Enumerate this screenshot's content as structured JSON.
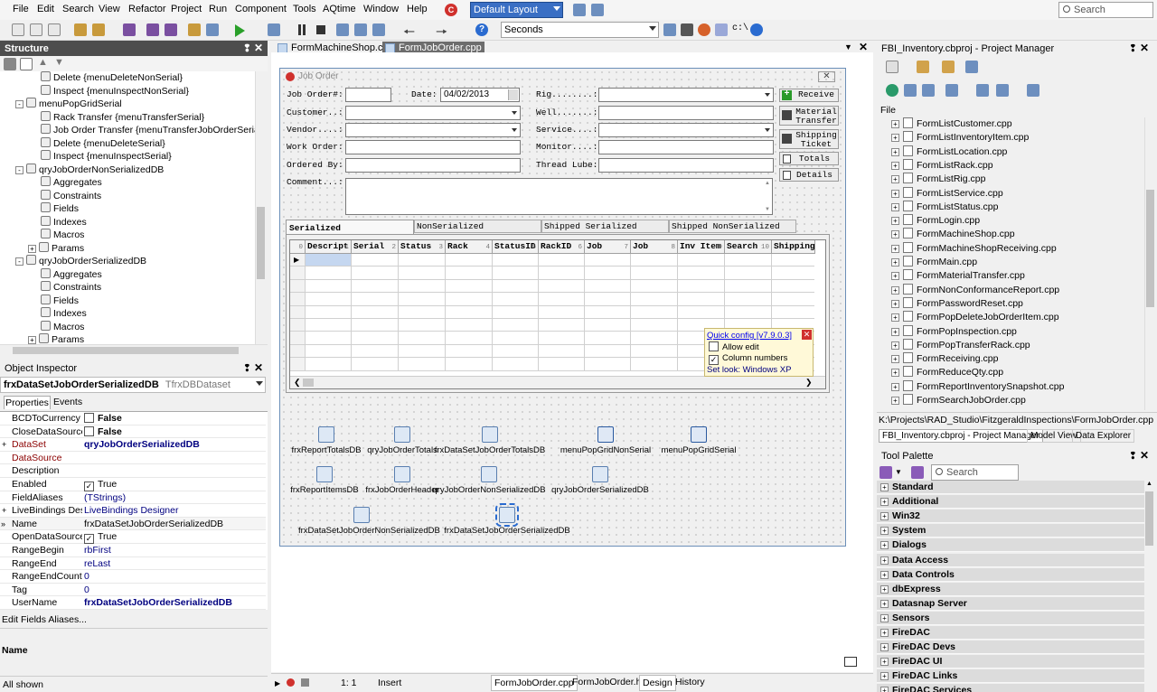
{
  "menu": {
    "items": [
      "File",
      "Edit",
      "Search",
      "View",
      "Refactor",
      "Project",
      "Run",
      "Component",
      "Tools",
      "AQtime",
      "Window",
      "Help"
    ],
    "layout_combo": "Default Layout",
    "search_placeholder": "Search"
  },
  "toolbar": {
    "time_unit": "Seconds"
  },
  "editor_tabs": [
    "FormMachineShop.cpp",
    "FormJobOrder.cpp"
  ],
  "structure": {
    "title": "Structure",
    "rows": [
      {
        "label": "Delete {menuDeleteNonSerial}",
        "indent": 3
      },
      {
        "label": "Inspect {menuInspectNonSerial}",
        "indent": 3
      },
      {
        "label": "menuPopGridSerial",
        "indent": 1,
        "exp": "-"
      },
      {
        "label": "Rack Transfer {menuTransferSerial}",
        "indent": 3
      },
      {
        "label": "Job Order Transfer {menuTransferJobOrderSerial}",
        "indent": 3
      },
      {
        "label": "Delete {menuDeleteSerial}",
        "indent": 3
      },
      {
        "label": "Inspect {menuInspectSerial}",
        "indent": 3
      },
      {
        "label": "qryJobOrderNonSerializedDB",
        "indent": 1,
        "exp": "-"
      },
      {
        "label": "Aggregates",
        "indent": 3
      },
      {
        "label": "Constraints",
        "indent": 3
      },
      {
        "label": "Fields",
        "indent": 3
      },
      {
        "label": "Indexes",
        "indent": 3
      },
      {
        "label": "Macros",
        "indent": 3
      },
      {
        "label": "Params",
        "indent": 2,
        "exp": "+"
      },
      {
        "label": "qryJobOrderSerializedDB",
        "indent": 1,
        "exp": "-"
      },
      {
        "label": "Aggregates",
        "indent": 3
      },
      {
        "label": "Constraints",
        "indent": 3
      },
      {
        "label": "Fields",
        "indent": 3
      },
      {
        "label": "Indexes",
        "indent": 3
      },
      {
        "label": "Macros",
        "indent": 3
      },
      {
        "label": "Params",
        "indent": 2,
        "exp": "+"
      }
    ]
  },
  "object_inspector": {
    "title": "Object Inspector",
    "selected_name": "frxDataSetJobOrderSerializedDB",
    "selected_type": "TfrxDBDataset",
    "tabs": [
      "Properties",
      "Events"
    ],
    "rows": [
      {
        "key": "BCDToCurrency",
        "value": "False",
        "chk": "off",
        "bold": true
      },
      {
        "key": "CloseDataSource",
        "value": "False",
        "chk": "off",
        "bold": true
      },
      {
        "key": "DataSet",
        "value": "qryJobOrderSerializedDB",
        "exp": "+",
        "keycolor": "#8b0000",
        "valcolor": "#000080",
        "bold": true
      },
      {
        "key": "DataSource",
        "value": "",
        "keycolor": "#8b0000"
      },
      {
        "key": "Description",
        "value": ""
      },
      {
        "key": "Enabled",
        "value": "True",
        "chk": "on"
      },
      {
        "key": "FieldAliases",
        "value": "(TStrings)",
        "valcolor": "#000080"
      },
      {
        "key": "LiveBindings Designer",
        "value": "LiveBindings Designer",
        "exp": "+",
        "valcolor": "#000080"
      },
      {
        "key": "Name",
        "value": "frxDataSetJobOrderSerializedDB",
        "selected": true
      },
      {
        "key": "OpenDataSource",
        "value": "True",
        "chk": "on"
      },
      {
        "key": "RangeBegin",
        "value": "rbFirst",
        "valcolor": "#000080"
      },
      {
        "key": "RangeEnd",
        "value": "reLast",
        "valcolor": "#000080"
      },
      {
        "key": "RangeEndCount",
        "value": "0",
        "valcolor": "#000080"
      },
      {
        "key": "Tag",
        "value": "0",
        "valcolor": "#000080"
      },
      {
        "key": "UserName",
        "value": "frxDataSetJobOrderSerializedDB",
        "valcolor": "#000080",
        "bold": true
      }
    ],
    "footer_link": "Edit Fields Aliases...",
    "desc_name": "Name",
    "status": "All shown"
  },
  "form": {
    "caption": "Job Order",
    "labels": {
      "job_order": "Job Order#:",
      "date": "Date:",
      "customer": "Customer..:",
      "vendor": "Vendor....:",
      "work_order": "Work Order:",
      "ordered_by": "Ordered By:",
      "comment": "Comment...:",
      "rig": "Rig........:",
      "well": "Well.......:",
      "service": "Service....:",
      "monitor": "Monitor....:",
      "thread_lube": "Thread Lube:"
    },
    "date_value": "04/02/2013",
    "buttons": {
      "receive": "Receive",
      "material_transfer_1": "Material",
      "material_transfer_2": "Transfer",
      "shipping_ticket_1": "Shipping",
      "shipping_ticket_2": "Ticket",
      "totals": "Totals",
      "details": "Details"
    },
    "grid_tabs": [
      "Serialized",
      "NonSerialized",
      "Shipped Serialized",
      "Shipped NonSerialized"
    ],
    "grid_columns": [
      {
        "label": "Descript",
        "num": "1"
      },
      {
        "label": "Serial",
        "num": "2"
      },
      {
        "label": "Status",
        "num": "3"
      },
      {
        "label": "Rack",
        "num": "4"
      },
      {
        "label": "StatusID",
        "num": "5"
      },
      {
        "label": "RackID",
        "num": "6"
      },
      {
        "label": "Job",
        "num": "7"
      },
      {
        "label": "Job",
        "num": "8"
      },
      {
        "label": "Inv Item",
        "num": "9"
      },
      {
        "label": "Search",
        "num": "10"
      },
      {
        "label": "Shipping",
        "num": ""
      }
    ],
    "grid_corner": "0",
    "quick_config": {
      "title": "Quick config [v7.9.0.3]",
      "allow_edit": "Allow edit",
      "column_numbers": "Column numbers",
      "set_look": "Set look: Windows XP"
    }
  },
  "components": [
    "frxReportTotalsDB",
    "qryJobOrderTotals",
    "frxDataSetJobOrderTotalsDB",
    "menuPopGridNonSerial",
    "menuPopGridSerial",
    "frxReportItemsDB",
    "frxJobOrderHeader",
    "qryJobOrderNonSerializedDB",
    "qryJobOrderSerializedDB",
    "frxDataSetJobOrderNonSerializedDB",
    "frxDataSetJobOrderSerializedDB"
  ],
  "editor_status": {
    "position": "1: 1",
    "mode": "Insert",
    "bottom_tabs": [
      "FormJobOrder.cpp",
      "FormJobOrder.h",
      "Design",
      "History"
    ]
  },
  "project_manager": {
    "title": "FBI_Inventory.cbproj - Project Manager",
    "root": "File",
    "files": [
      "FormListCustomer.cpp",
      "FormListInventoryItem.cpp",
      "FormListLocation.cpp",
      "FormListRack.cpp",
      "FormListRig.cpp",
      "FormListService.cpp",
      "FormListStatus.cpp",
      "FormLogin.cpp",
      "FormMachineShop.cpp",
      "FormMachineShopReceiving.cpp",
      "FormMain.cpp",
      "FormMaterialTransfer.cpp",
      "FormNonConformanceReport.cpp",
      "FormPasswordReset.cpp",
      "FormPopDeleteJobOrderItem.cpp",
      "FormPopInspection.cpp",
      "FormPopTransferRack.cpp",
      "FormReceiving.cpp",
      "FormReduceQty.cpp",
      "FormReportInventorySnapshot.cpp",
      "FormSearchJobOrder.cpp"
    ],
    "path": "K:\\Projects\\RAD_Studio\\FitzgeraldInspections\\FormJobOrder.cpp",
    "tabs": [
      "FBI_Inventory.cbproj - Project Manager",
      "Model View",
      "Data Explorer"
    ]
  },
  "tool_palette": {
    "title": "Tool Palette",
    "search_placeholder": "Search",
    "categories": [
      "Standard",
      "Additional",
      "Win32",
      "System",
      "Dialogs",
      "Data Access",
      "Data Controls",
      "dbExpress",
      "Datasnap Server",
      "Sensors",
      "FireDAC",
      "FireDAC Devs",
      "FireDAC UI",
      "FireDAC Links",
      "FireDAC Services"
    ]
  }
}
